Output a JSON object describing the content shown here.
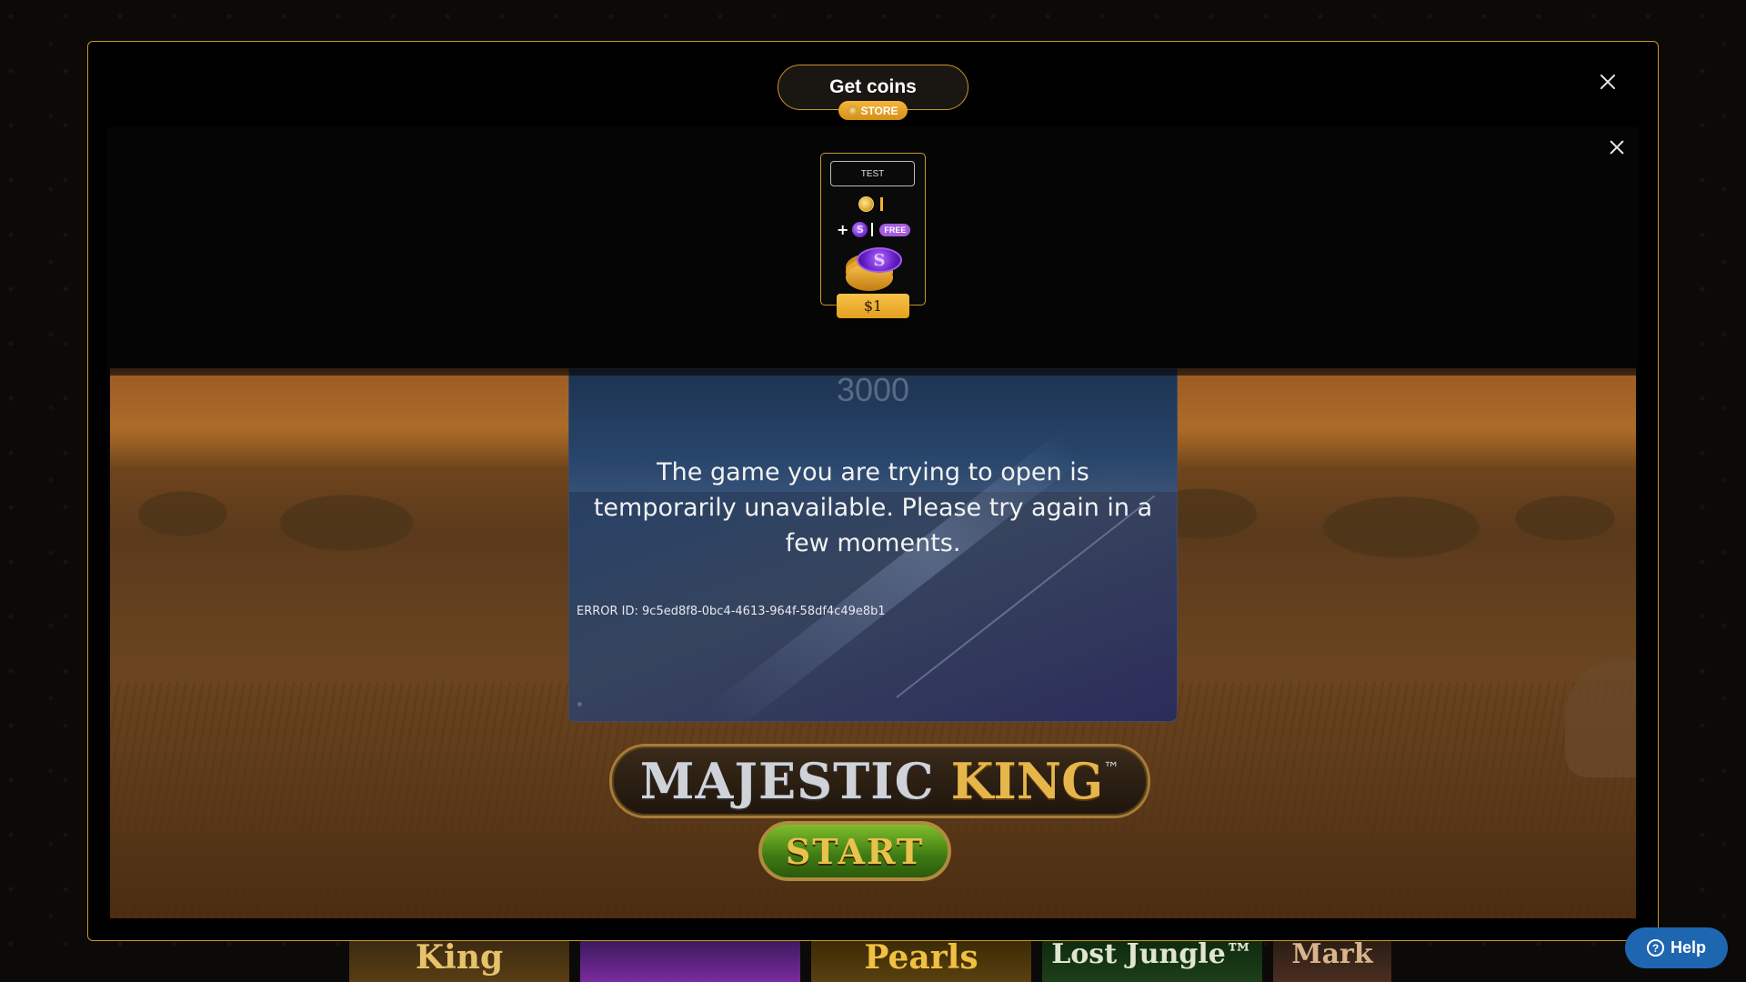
{
  "store_modal": {
    "get_coins_label": "Get coins",
    "store_badge_label": "STORE",
    "close_icon": "close-icon"
  },
  "offer": {
    "tag_label": "TEST",
    "gold_coin_icon": "gold-coin-icon",
    "sweeps_prefix": "+",
    "sweeps_coin_glyph": "S",
    "free_label": "FREE",
    "stack_glyph": "S",
    "price": "$1"
  },
  "game": {
    "title_word1": "MAJESTIC",
    "title_word2": "KING",
    "trademark": "™",
    "start_label": "START"
  },
  "error_dialog": {
    "amount": "3000",
    "message": "The game you are trying to open is temporarily unavailable. Please try again in a few moments.",
    "error_id": "ERROR ID: 9c5ed8f8-0bc4-4613-964f-58df4c49e8b1"
  },
  "thumbnails": [
    {
      "label": "King"
    },
    {
      "label": ""
    },
    {
      "label": "Pearls"
    },
    {
      "label": "Lost Jungle™"
    },
    {
      "label": "Mark"
    }
  ],
  "help": {
    "label": "Help",
    "icon_glyph": "?"
  },
  "colors": {
    "accent_gold": "#c8962a",
    "help_blue": "#1f66b0",
    "free_purple": "#a45ce0"
  }
}
